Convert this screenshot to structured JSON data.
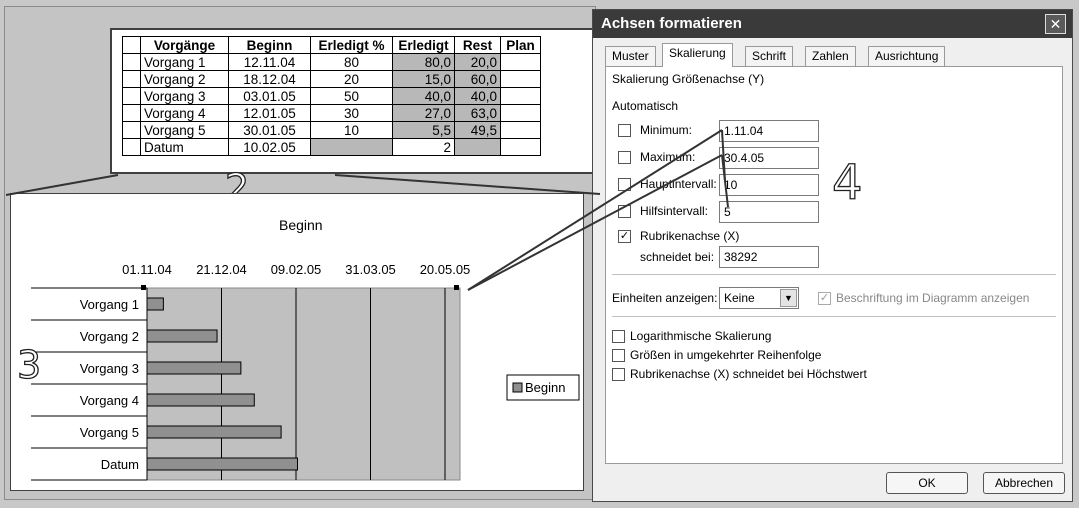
{
  "sheet": {
    "headers": [
      "",
      "Vorgänge",
      "Beginn",
      "Erledigt %",
      "Erledigt",
      "Rest",
      "Plan"
    ],
    "rows": [
      [
        "",
        "Vorgang 1",
        "12.11.04",
        "80",
        "80,0",
        "20,0",
        ""
      ],
      [
        "",
        "Vorgang 2",
        "18.12.04",
        "20",
        "15,0",
        "60,0",
        ""
      ],
      [
        "",
        "Vorgang 3",
        "03.01.05",
        "50",
        "40,0",
        "40,0",
        ""
      ],
      [
        "",
        "Vorgang 4",
        "12.01.05",
        "30",
        "27,0",
        "63,0",
        ""
      ],
      [
        "",
        "Vorgang 5",
        "30.01.05",
        "10",
        "5,5",
        "49,5",
        ""
      ],
      [
        "",
        "Datum",
        "10.02.05",
        "",
        "2",
        "",
        ""
      ]
    ]
  },
  "callouts": {
    "two": "2",
    "three": "3",
    "four": "4"
  },
  "chart_data": {
    "type": "bar",
    "title": "Beginn",
    "orientation": "horizontal",
    "categories": [
      "Vorgang 1",
      "Vorgang 2",
      "Vorgang 3",
      "Vorgang 4",
      "Vorgang 5",
      "Datum"
    ],
    "series": [
      {
        "name": "Beginn",
        "values": [
          "12.11.04",
          "18.12.04",
          "03.01.05",
          "12.01.05",
          "30.01.05",
          "10.02.05"
        ]
      }
    ],
    "x_ticks": [
      "01.11.04",
      "21.12.04",
      "09.02.05",
      "31.03.05",
      "20.05.05"
    ],
    "xlim": [
      "01.11.04",
      "30.04.05"
    ],
    "legend_position": "right",
    "bar_color": "#909090",
    "plot_background": "#c0c0c0"
  },
  "dialog": {
    "title": "Achsen formatieren",
    "close_glyph": "✕",
    "tabs": [
      "Muster",
      "Skalierung",
      "Schrift",
      "Zahlen",
      "Ausrichtung"
    ],
    "active_tab": "Skalierung",
    "section_title": "Skalierung Größenachse (Y)",
    "auto_label": "Automatisch",
    "fields": {
      "minimum": {
        "label": "Minimum:",
        "value": "1.11.04",
        "checked": false
      },
      "maximum": {
        "label": "Maximum:",
        "value": "30.4.05",
        "checked": false
      },
      "major": {
        "label": "Hauptintervall:",
        "value": "10",
        "checked": false
      },
      "minor": {
        "label": "Hilfsintervall:",
        "value": "5",
        "checked": false
      },
      "category_axis": {
        "label": "Rubrikenachse (X)",
        "checked": true
      }
    },
    "crosses_label": "schneidet bei:",
    "crosses_value": "38292",
    "units_label": "Einheiten anzeigen:",
    "units_value": "Keine",
    "units_caption_label": "Beschriftung im Diagramm anzeigen",
    "options": [
      {
        "label": "Logarithmische Skalierung",
        "checked": false
      },
      {
        "label": "Größen in umgekehrter Reihenfolge",
        "checked": false
      },
      {
        "label": "Rubrikenachse (X) schneidet bei Höchstwert",
        "checked": false
      }
    ],
    "ok_label": "OK",
    "cancel_label": "Abbrechen"
  }
}
